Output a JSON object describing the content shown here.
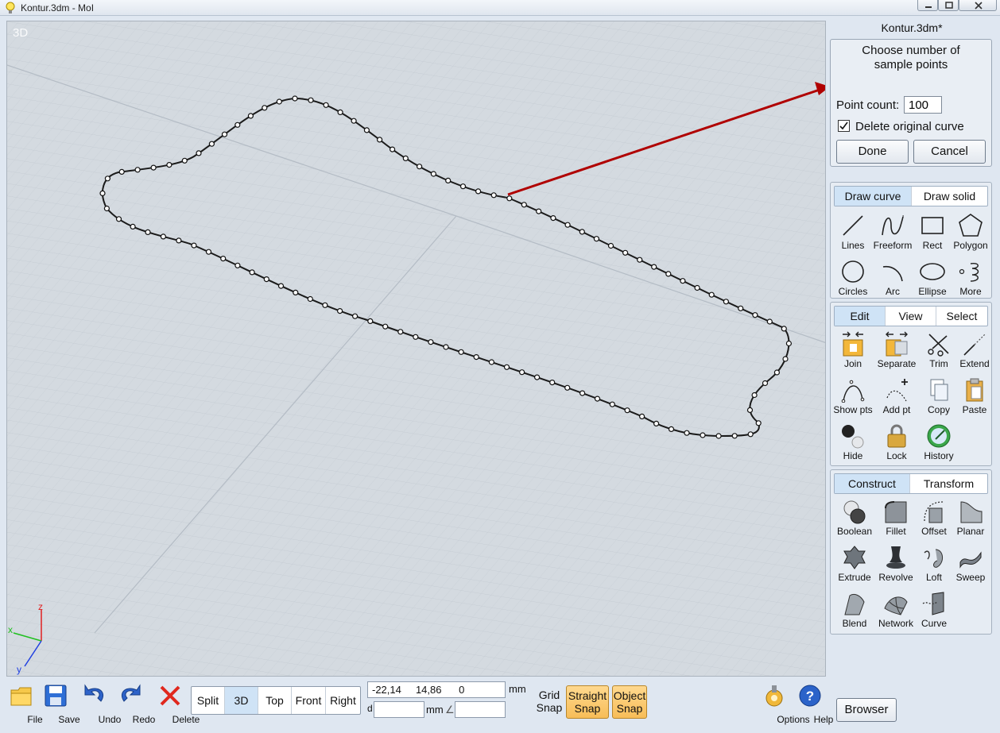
{
  "window": {
    "title": "Kontur.3dm - MoI"
  },
  "viewport": {
    "label": "3D"
  },
  "panel": {
    "doc_title": "Kontur.3dm*",
    "command": {
      "prompt_line1": "Choose number of",
      "prompt_line2": "sample points",
      "point_count_label": "Point count:",
      "point_count_value": "100",
      "delete_original_label": "Delete original curve",
      "delete_original_checked": true,
      "done_label": "Done",
      "cancel_label": "Cancel"
    },
    "draw_tabs": [
      "Draw curve",
      "Draw solid"
    ],
    "draw_tools": [
      "Lines",
      "Freeform",
      "Rect",
      "Polygon",
      "Circles",
      "Arc",
      "Ellipse",
      "More"
    ],
    "edit_tabs": [
      "Edit",
      "View",
      "Select"
    ],
    "edit_tools": [
      "Join",
      "Separate",
      "Trim",
      "Extend",
      "Show pts",
      "Add pt",
      "Copy",
      "Paste",
      "Hide",
      "Lock",
      "History"
    ],
    "construct_tabs": [
      "Construct",
      "Transform"
    ],
    "construct_tools": [
      "Boolean",
      "Fillet",
      "Offset",
      "Planar",
      "Extrude",
      "Revolve",
      "Loft",
      "Sweep",
      "Blend",
      "Network",
      "Curve"
    ]
  },
  "bottom": {
    "file": "File",
    "save": "Save",
    "undo": "Undo",
    "redo": "Redo",
    "delete": "Delete",
    "views": [
      "Split",
      "3D",
      "Top",
      "Front",
      "Right"
    ],
    "active_view": "3D",
    "coord_x": "-22,14",
    "coord_y": "14,86",
    "coord_z": "0",
    "unit": "mm",
    "distance_label": "d",
    "grid_snap_line1": "Grid",
    "grid_snap_line2": "Snap",
    "straight_snap_line1": "Straight",
    "straight_snap_line2": "Snap",
    "object_snap_line1": "Object",
    "object_snap_line2": "Snap",
    "options": "Options",
    "help": "Help",
    "browser": "Browser"
  },
  "axes": {
    "x": "x",
    "y": "y",
    "z": "z"
  },
  "colors": {
    "arrow": "#b00000",
    "snap_on": "#f7bd58",
    "active_tab": "#cfe3f6"
  }
}
